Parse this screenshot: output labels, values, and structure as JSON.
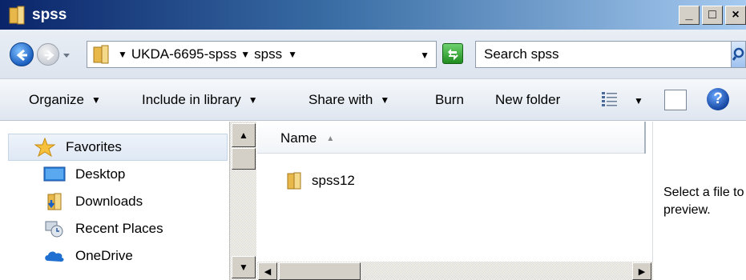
{
  "window": {
    "title": "spss",
    "buttons": {
      "minimize": "_",
      "maximize": "□",
      "close": "×"
    }
  },
  "address": {
    "breadcrumbs": [
      "UKDA-6695-spss",
      "spss"
    ],
    "dropdown_arrow": "▼"
  },
  "search": {
    "placeholder": "Search spss"
  },
  "toolbar": {
    "organize": "Organize",
    "include_in_library": "Include in library",
    "share_with": "Share with",
    "burn": "Burn",
    "new_folder": "New folder",
    "help": "?"
  },
  "navigation": {
    "favorites": "Favorites",
    "items": [
      "Desktop",
      "Downloads",
      "Recent Places",
      "OneDrive"
    ]
  },
  "files": {
    "column_name": "Name",
    "items": [
      {
        "name": "spss12",
        "type": "folder"
      }
    ]
  },
  "preview": {
    "message": "Select a file to preview."
  },
  "colors": {
    "titlebar_start": "#0a246a",
    "titlebar_end": "#a6caf0",
    "folder": "#e8b84a"
  }
}
